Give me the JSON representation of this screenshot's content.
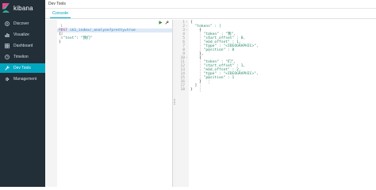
{
  "app": {
    "name": "kibana",
    "section_title": "Dev Tools"
  },
  "sidebar": {
    "items": [
      {
        "label": "Discover",
        "icon": "compass-icon",
        "active": false
      },
      {
        "label": "Visualize",
        "icon": "bar-chart-icon",
        "active": false
      },
      {
        "label": "Dashboard",
        "icon": "dashboard-icon",
        "active": false
      },
      {
        "label": "Timelion",
        "icon": "timelion-icon",
        "active": false
      },
      {
        "label": "Dev Tools",
        "icon": "wrench-icon",
        "active": true
      },
      {
        "label": "Management",
        "icon": "gear-icon",
        "active": false
      }
    ]
  },
  "tabs": [
    {
      "label": "Console",
      "active": true
    }
  ],
  "request": {
    "lines": [
      {
        "n": "1",
        "method": "POST",
        "url": " ik1_index/_analyze?pretty=true"
      },
      {
        "n": "2",
        "text": "{"
      },
      {
        "n": "3",
        "key": "  \"text\"",
        "sep": ": ",
        "str": "\"我们\""
      },
      {
        "n": "4",
        "text": "}"
      }
    ]
  },
  "response": {
    "lines": [
      {
        "n": "1",
        "fold": "-",
        "text": "{"
      },
      {
        "n": "2",
        "fold": "-",
        "text": "  \"tokens\" : ["
      },
      {
        "n": "3",
        "fold": "-",
        "text": "    {"
      },
      {
        "n": "4",
        "fold": "",
        "text": "      \"token\" : \"我\","
      },
      {
        "n": "5",
        "fold": "",
        "text": "      \"start_offset\" : 0,"
      },
      {
        "n": "6",
        "fold": "",
        "text": "      \"end_offset\" : 1,"
      },
      {
        "n": "7",
        "fold": "",
        "text": "      \"type\" : \"<IDEOGRAPHIC>\","
      },
      {
        "n": "8",
        "fold": "",
        "text": "      \"position\" : 0"
      },
      {
        "n": "9",
        "fold": "",
        "text": "    },"
      },
      {
        "n": "10",
        "fold": "-",
        "text": "    {"
      },
      {
        "n": "11",
        "fold": "",
        "text": "      \"token\" : \"们\","
      },
      {
        "n": "12",
        "fold": "",
        "text": "      \"start_offset\" : 1,"
      },
      {
        "n": "13",
        "fold": "",
        "text": "      \"end_offset\" : 2,"
      },
      {
        "n": "14",
        "fold": "",
        "text": "      \"type\" : \"<IDEOGRAPHIC>\","
      },
      {
        "n": "15",
        "fold": "",
        "text": "      \"position\" : 1"
      },
      {
        "n": "16",
        "fold": "",
        "text": "    }"
      },
      {
        "n": "17",
        "fold": "",
        "text": "  ]"
      },
      {
        "n": "18",
        "fold": "",
        "text": "}"
      }
    ]
  },
  "colors": {
    "sidebar_bg": "#222e38",
    "accent": "#00a6bf",
    "method": "#a35c8f",
    "url": "#3a8ac9",
    "string": "#2a8a6e"
  },
  "toolbar": {
    "run_icon": "play-icon",
    "settings_icon": "wrench-icon"
  }
}
